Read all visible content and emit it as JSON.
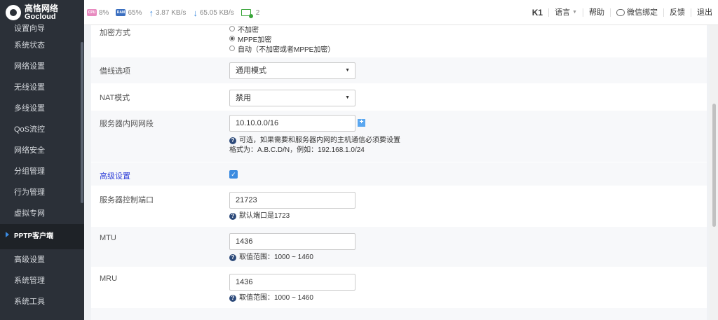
{
  "brand": {
    "line1": "高恪网络",
    "line2": "Gocloud"
  },
  "status": {
    "cpu_chip": "CPU",
    "cpu": "8%",
    "ram_chip": "RAM",
    "ram": "65%",
    "upload": "3.87 KB/s",
    "download": "65.05 KB/s",
    "clients": "2"
  },
  "topnav": {
    "device": "K1",
    "language": "语言",
    "help": "帮助",
    "wechat": "微信绑定",
    "feedback": "反馈",
    "logout": "退出"
  },
  "sidebar": {
    "items": [
      {
        "label": "设置向导"
      },
      {
        "label": "系统状态"
      },
      {
        "label": "网络设置"
      },
      {
        "label": "无线设置"
      },
      {
        "label": "多线设置"
      },
      {
        "label": "QoS流控"
      },
      {
        "label": "网络安全"
      },
      {
        "label": "分组管理"
      },
      {
        "label": "行为管理"
      },
      {
        "label": "虚拟专网"
      },
      {
        "label": "PPTP客户端"
      },
      {
        "label": "高级设置"
      },
      {
        "label": "系统管理"
      },
      {
        "label": "系统工具"
      }
    ],
    "active": "PPTP客户端"
  },
  "form": {
    "encryption": {
      "label": "加密方式",
      "options": [
        "不加密",
        "MPPE加密",
        "自动（不加密或者MPPE加密）"
      ],
      "selected": "MPPE加密"
    },
    "line_option": {
      "label": "借线选项",
      "value": "通用模式"
    },
    "nat": {
      "label": "NAT模式",
      "value": "禁用"
    },
    "server_lan": {
      "label": "服务器内网网段",
      "value": "10.10.0.0/16",
      "help": "可选，如果需要和服务器内网的主机通信必须要设置",
      "format": "格式为：A.B.C.D/N，例如：192.168.1.0/24"
    },
    "advanced": {
      "label": "高级设置",
      "checked": true
    },
    "control_port": {
      "label": "服务器控制端口",
      "value": "21723",
      "help": "默认端口是1723"
    },
    "mtu": {
      "label": "MTU",
      "value": "1436",
      "help": "取值范围：1000 ~ 1460"
    },
    "mru": {
      "label": "MRU",
      "value": "1436",
      "help": "取值范围：1000 ~ 1460"
    }
  }
}
